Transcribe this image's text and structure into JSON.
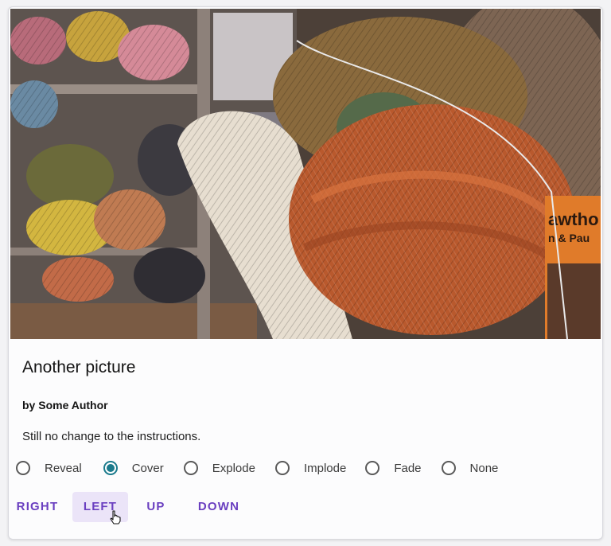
{
  "card": {
    "title": "Another picture",
    "author": "by Some Author",
    "description": "Still no change to the instructions."
  },
  "photo": {
    "subject": "skeins of yarn in a shop",
    "label_line1": "awtho",
    "label_line2": "n & Pau"
  },
  "transitions": {
    "selected": "Cover",
    "options": [
      "Reveal",
      "Cover",
      "Explode",
      "Implode",
      "Fade",
      "None"
    ]
  },
  "directions": {
    "right": "RIGHT",
    "left": "LEFT",
    "up": "UP",
    "down": "DOWN"
  },
  "colors": {
    "accent": "#6a3fc0",
    "radio_selected": "#1a7a8c",
    "button_hover_bg": "#ebe4f8"
  }
}
